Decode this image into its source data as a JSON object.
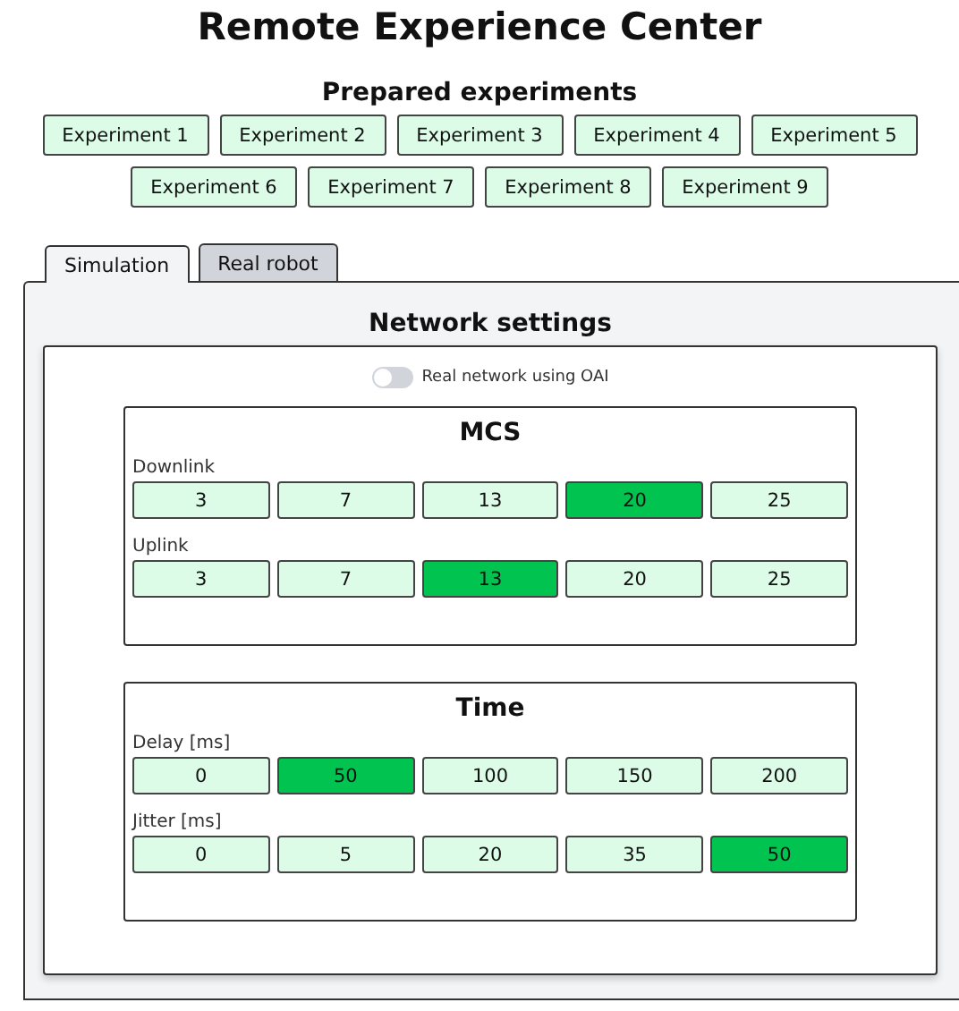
{
  "title": "Remote Experience Center",
  "experiments": {
    "heading": "Prepared experiments",
    "buttons": [
      "Experiment 1",
      "Experiment 2",
      "Experiment 3",
      "Experiment 4",
      "Experiment 5",
      "Experiment 6",
      "Experiment 7",
      "Experiment 8",
      "Experiment 9"
    ]
  },
  "tabs": [
    {
      "label": "Simulation",
      "selected": true
    },
    {
      "label": "Real robot",
      "selected": false
    }
  ],
  "network_settings": {
    "heading": "Network settings",
    "toggle": {
      "label": "Real network using OAI",
      "on": false
    },
    "groups": [
      {
        "title": "MCS",
        "rows": [
          {
            "label": "Downlink",
            "options": [
              {
                "label": "3",
                "selected": false
              },
              {
                "label": "7",
                "selected": false
              },
              {
                "label": "13",
                "selected": false
              },
              {
                "label": "20",
                "selected": true
              },
              {
                "label": "25",
                "selected": false
              }
            ]
          },
          {
            "label": "Uplink",
            "options": [
              {
                "label": "3",
                "selected": false
              },
              {
                "label": "7",
                "selected": false
              },
              {
                "label": "13",
                "selected": true
              },
              {
                "label": "20",
                "selected": false
              },
              {
                "label": "25",
                "selected": false
              }
            ]
          }
        ]
      },
      {
        "title": "Time",
        "rows": [
          {
            "label": "Delay [ms]",
            "options": [
              {
                "label": "0",
                "selected": false
              },
              {
                "label": "50",
                "selected": true
              },
              {
                "label": "100",
                "selected": false
              },
              {
                "label": "150",
                "selected": false
              },
              {
                "label": "200",
                "selected": false
              }
            ]
          },
          {
            "label": "Jitter [ms]",
            "options": [
              {
                "label": "0",
                "selected": false
              },
              {
                "label": "5",
                "selected": false
              },
              {
                "label": "20",
                "selected": false
              },
              {
                "label": "35",
                "selected": false
              },
              {
                "label": "50",
                "selected": true
              }
            ]
          }
        ]
      }
    ]
  }
}
